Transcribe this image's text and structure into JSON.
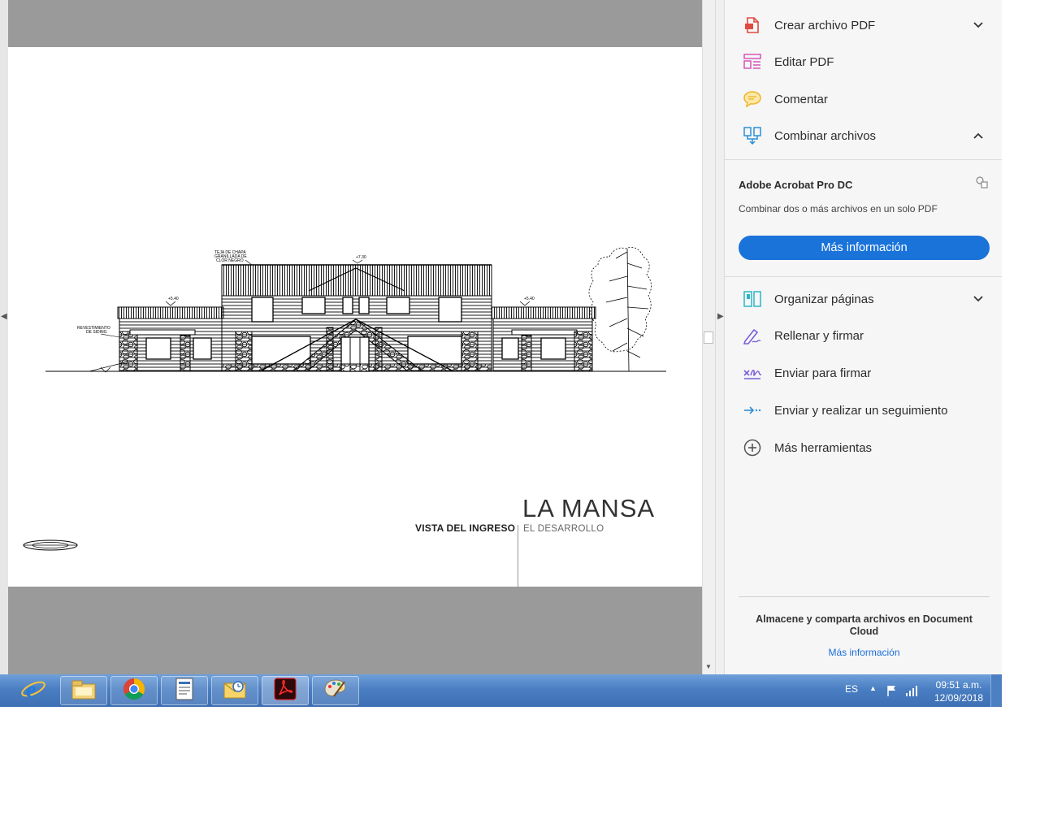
{
  "drawing": {
    "view_label": "VISTA DEL INGRESO",
    "project_name": "LA MANSA",
    "project_subtitle": "EL DESARROLLO",
    "annotations": {
      "roof_material": [
        "TEJA DE CHAPA",
        "GRANILLADA DE",
        "CLOR NEGRO"
      ],
      "siding": [
        "REVESTIMIENTO",
        "DE SIDING"
      ],
      "level_top": "+7.30",
      "level_left": "+5.40",
      "level_right": "+5.40"
    }
  },
  "tools": {
    "items": [
      {
        "label": "Crear archivo PDF",
        "icon": "create-pdf-icon",
        "chevron": "down"
      },
      {
        "label": "Editar PDF",
        "icon": "edit-pdf-icon"
      },
      {
        "label": "Comentar",
        "icon": "comment-icon"
      },
      {
        "label": "Combinar archivos",
        "icon": "combine-files-icon",
        "chevron": "up"
      },
      {
        "label": "Organizar páginas",
        "icon": "organize-pages-icon",
        "chevron": "down"
      },
      {
        "label": "Rellenar y firmar",
        "icon": "fill-sign-icon"
      },
      {
        "label": "Enviar para firmar",
        "icon": "send-for-signature-icon"
      },
      {
        "label": "Enviar y realizar un seguimiento",
        "icon": "send-track-icon"
      },
      {
        "label": "Más herramientas",
        "icon": "more-tools-icon"
      }
    ],
    "promo": {
      "title": "Adobe Acrobat Pro DC",
      "description": "Combinar dos o más archivos en un solo PDF",
      "button": "Más información"
    },
    "storage": {
      "text": "Almacene y comparta archivos en Document Cloud",
      "link": "Más información"
    }
  },
  "taskbar": {
    "apps": [
      "internet-explorer-icon",
      "file-explorer-icon",
      "chrome-icon",
      "document-icon",
      "outlook-icon",
      "acrobat-icon",
      "paint-icon"
    ],
    "language": "ES",
    "time": "09:51 a.m.",
    "date": "12/09/2018"
  },
  "colors": {
    "accent": "#1a73d9",
    "taskbar": "#4a7ec2",
    "viewer_bg": "#9a9a9a"
  }
}
